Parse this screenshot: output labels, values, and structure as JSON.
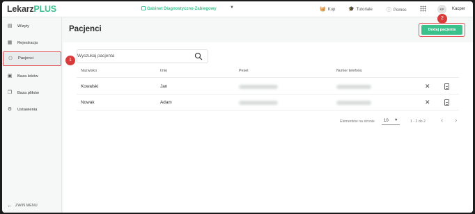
{
  "app": {
    "logo_main": "Lekarz",
    "logo_accent": "PLUS",
    "clinic": "Gabinet Diagnostyczno-Zabiegowy"
  },
  "topnav": {
    "shop": "Kup",
    "tutorials": "Tutoriale",
    "help": "Pomoc",
    "avatar_initials": "KP",
    "user": "Kacper"
  },
  "sidebar": {
    "items": [
      {
        "label": "Wizyty",
        "icon": "clipboard-icon"
      },
      {
        "label": "Rejestracja",
        "icon": "register-icon"
      },
      {
        "label": "Pacjenci",
        "icon": "patients-icon"
      },
      {
        "label": "Baza leków",
        "icon": "medicine-icon"
      },
      {
        "label": "Baza plików",
        "icon": "files-icon"
      },
      {
        "label": "Ustawienia",
        "icon": "gear-icon"
      }
    ],
    "collapse": "ZWIŃ MENU"
  },
  "main": {
    "title": "Pacjenci",
    "add_button": "Dodaj pacjenta",
    "search_placeholder": "Wyszukaj pacjenta"
  },
  "table": {
    "columns": [
      "Nazwisko",
      "Imię",
      "Pesel",
      "Numer telefonu"
    ],
    "rows": [
      {
        "surname": "Kowalski",
        "name": "Jan"
      },
      {
        "surname": "Nowak",
        "name": "Adam"
      }
    ]
  },
  "pagination": {
    "per_page_label": "Elementów na stronie",
    "per_page": "10",
    "range": "1 - 2 do 2"
  },
  "annotations": {
    "badge1": "1",
    "badge2": "2"
  },
  "colors": {
    "accent": "#3cc18d",
    "highlight": "#e15759",
    "badge": "#d93a3a"
  }
}
